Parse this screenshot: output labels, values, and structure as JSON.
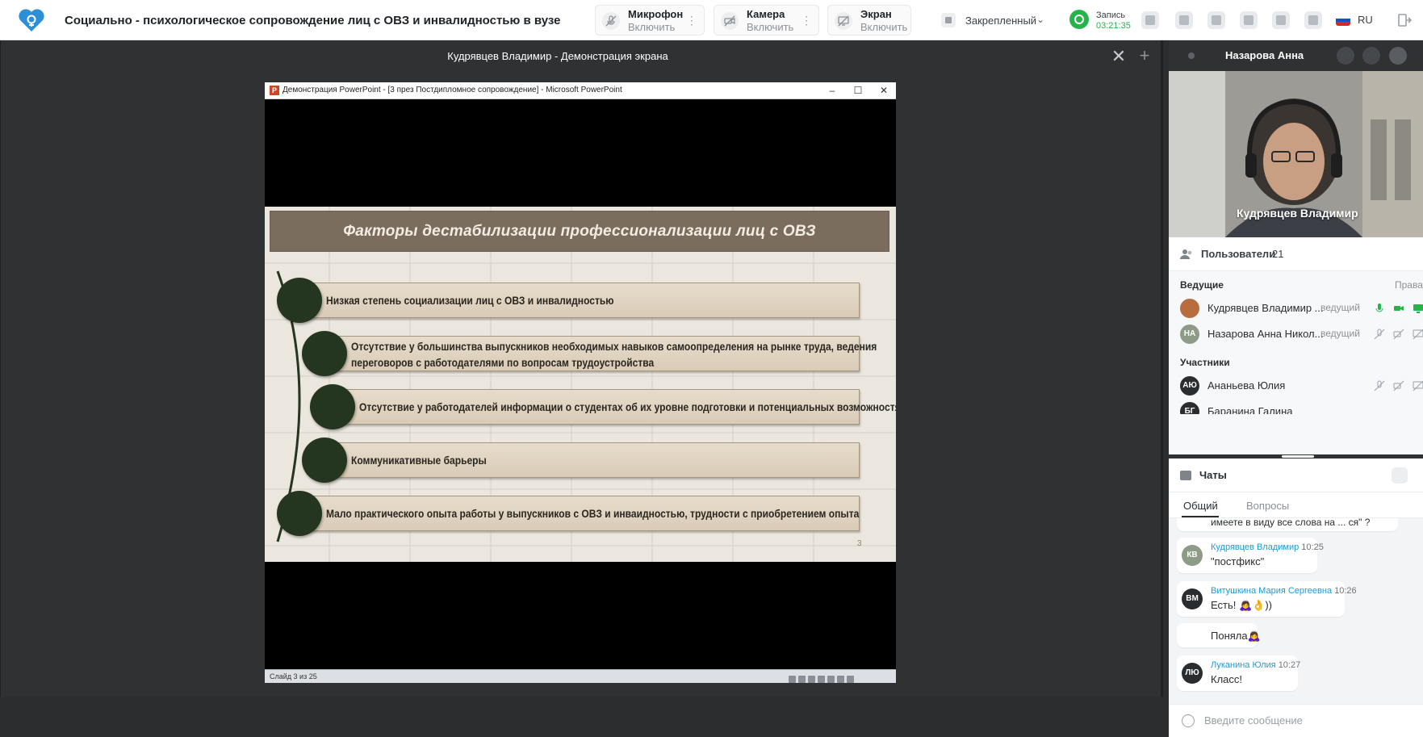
{
  "app": {
    "title": "Социально - психологическое сопровождение лиц с ОВЗ и инвалидностью в вузе",
    "accent": "#2d8fd8"
  },
  "controls": {
    "mic": {
      "label": "Микрофон",
      "action": "Включить"
    },
    "camera": {
      "label": "Камера",
      "action": "Включить"
    },
    "screen": {
      "label": "Экран",
      "action": "Включить"
    },
    "pinned": "Закрепленный",
    "record": {
      "label": "Запись",
      "time": "03:21:35"
    },
    "lang": "RU"
  },
  "stage": {
    "title": "Кудрявцев Владимир - Демонстрация экрана"
  },
  "ppt": {
    "window_title": "Демонстрация PowerPoint - [3 през Постдипломное сопровождение] - Microsoft PowerPoint",
    "status": "Слайд 3 из 25",
    "slide": {
      "title": "Факторы дестабилизации профессионализации лиц с ОВЗ",
      "items": [
        {
          "line1": "Низкая степень социализации лиц с ОВЗ и инвалидностью",
          "line2": ""
        },
        {
          "line1": "Отсутствие у большинства выпускников необходимых навыков самоопределения на рынке труда, ведения",
          "line2": "переговоров с работодателями по вопросам трудоустройства"
        },
        {
          "line1": "Отсутствие у работодателей  информации о студентах об их уровне подготовки и потенциальных возможностях",
          "line2": ""
        },
        {
          "line1": "Коммуникативные барьеры",
          "line2": ""
        },
        {
          "line1": "Мало практического опыта работы  у выпускников с ОВЗ и инваидностью, трудности с приобретением опыта",
          "line2": ""
        }
      ],
      "number": "3"
    }
  },
  "right": {
    "video_header_name": "Назарова Анна",
    "video_name": "Кудрявцев Владимир",
    "users": {
      "title": "Пользователи",
      "count": "21",
      "hosts_label": "Ведущие",
      "rights_label": "Права",
      "participants_label": "Участники",
      "hosts": [
        {
          "initials": "",
          "name": "Кудрявцев Владимир ...",
          "role": "ведущий"
        },
        {
          "initials": "НА",
          "name": "Назарова Анна Никол...",
          "role": "ведущий"
        }
      ],
      "participants": [
        {
          "initials": "АЮ",
          "name": "Ананьева Юлия"
        },
        {
          "initials": "БГ",
          "name": "Баранина Галина"
        }
      ]
    },
    "chats": {
      "title": "Чаты",
      "tabs": [
        "Общий",
        "Вопросы"
      ],
      "messages": [
        {
          "initials": "",
          "author": "",
          "time": "",
          "text": "имеете в виду все слова на ... ся\" ?"
        },
        {
          "initials": "КВ",
          "author": "Кудрявцев Владимир",
          "time": "10:25",
          "text": "\"постфикс\""
        },
        {
          "initials": "ВМ",
          "author": "Витушкина Мария Сергеевна",
          "time": "10:26",
          "text": "Есть! 🙇‍♀️👌))"
        },
        {
          "initials": "",
          "author": "",
          "time": "",
          "text": "Поняла🙇‍♀️"
        },
        {
          "initials": "ЛЮ",
          "author": "Луканина Юлия",
          "time": "10:27",
          "text": "Класс!"
        }
      ],
      "placeholder": "Введите сообщение"
    }
  }
}
